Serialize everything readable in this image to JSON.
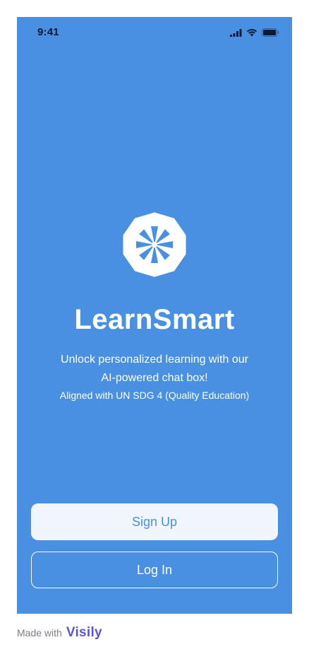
{
  "status_bar": {
    "time": "9:41",
    "icons": [
      "cellular-signal-icon",
      "wifi-icon",
      "battery-icon"
    ]
  },
  "app": {
    "logo_icon": "shutter-icon",
    "title": "LearnSmart",
    "tagline_line1": "Unlock personalized learning with our",
    "tagline_line2": "AI-powered chat box!",
    "tagline_line3": "Aligned with UN SDG 4 (Quality Education)"
  },
  "actions": {
    "signup_label": "Sign Up",
    "login_label": "Log In"
  },
  "footer": {
    "made_with": "Made with",
    "brand": "Visily"
  },
  "colors": {
    "background": "#4a90e2",
    "signup_bg": "#f0f6fc",
    "text": "#ffffff",
    "brand": "#5a55d6"
  }
}
